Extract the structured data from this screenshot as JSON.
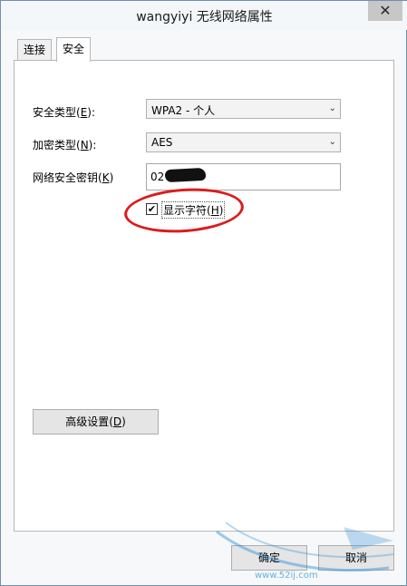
{
  "window": {
    "title": "wangyiyi 无线网络属性",
    "close_glyph": "✕"
  },
  "tabs": [
    {
      "label": "连接",
      "active": false
    },
    {
      "label": "安全",
      "active": true
    }
  ],
  "security": {
    "security_type_label_pre": "安全类型(",
    "security_type_key": "E",
    "security_type_label_post": "):",
    "security_type_value": "WPA2 - 个人",
    "encryption_type_label_pre": "加密类型(",
    "encryption_type_key": "N",
    "encryption_type_label_post": "):",
    "encryption_type_value": "AES",
    "key_label_pre": "网络安全密钥(",
    "key_key": "K",
    "key_label_post": ")",
    "key_value_visible": "02",
    "show_chars_label_pre": "显示字符(",
    "show_chars_key": "H",
    "show_chars_label_post": ")",
    "show_chars_checked": true,
    "check_glyph": "✔",
    "dropdown_arrow": "⌄"
  },
  "advanced": {
    "label_pre": "高级设置(",
    "key": "D",
    "label_post": ")"
  },
  "footer": {
    "ok_label": "确定",
    "cancel_label": "取消"
  },
  "watermark": {
    "text": "www.52ij.com"
  },
  "colors": {
    "annotation_ring": "#dd1b1b",
    "watermark": "#2b8fd6"
  }
}
